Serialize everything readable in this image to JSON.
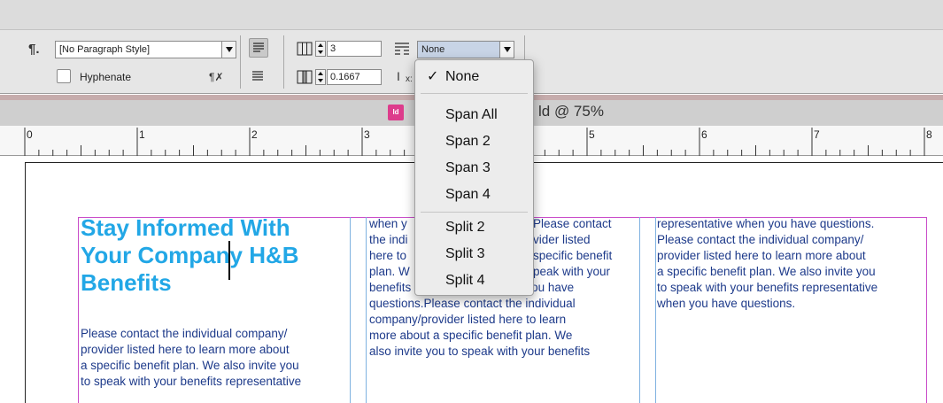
{
  "control_panel": {
    "paragraph_style": "[No Paragraph Style]",
    "hyphenate_label": "Hyphenate",
    "columns_value": "3",
    "gutter_value": "0.1667",
    "span_columns_value": "None",
    "icons": {
      "paragraph": "pilcrow-icon",
      "align_left": "align-left-icon",
      "justify": "justify-icon",
      "columns": "columns-icon",
      "gutter": "gutter-icon",
      "span": "span-columns-icon",
      "baseline": "text-cursor-icon"
    }
  },
  "document": {
    "title_fragment": "ld @ 75%",
    "app_icon_label": "Id",
    "ruler_numbers": [
      "0",
      "1",
      "2",
      "3",
      "4",
      "5",
      "6",
      "7",
      "8"
    ]
  },
  "span_menu": {
    "items": [
      "None",
      "Span All",
      "Span 2",
      "Span 3",
      "Span 4",
      "Split 2",
      "Split 3",
      "Split 4"
    ],
    "selected": "None"
  },
  "story": {
    "heading_lines": [
      "Stay Informed With",
      "Your Company H&B",
      "Benefits"
    ],
    "column1_lines": [
      "Please contact the individual company/",
      "provider listed here to learn more about",
      "a specific benefit plan. We also invite you",
      "to speak with your benefits representative"
    ],
    "column2_lines": [
      [
        "when y",
        "Please contact"
      ],
      [
        "the indi",
        "vider listed"
      ],
      [
        "here to ",
        "specific benefit"
      ],
      [
        "plan. W",
        "peak with your"
      ],
      [
        "benefits representative when you have",
        ""
      ],
      [
        "questions.Please contact the individual",
        ""
      ],
      [
        "company/provider listed here to learn",
        ""
      ],
      [
        "more about a specific benefit plan. We",
        ""
      ],
      [
        "also invite you to speak with your benefits",
        ""
      ]
    ],
    "column3_lines": [
      "representative when you have questions.",
      "Please contact the individual company/",
      "provider listed here to learn more about",
      "a specific benefit plan. We also invite you",
      "to speak with your benefits representative",
      "when you have questions."
    ]
  }
}
